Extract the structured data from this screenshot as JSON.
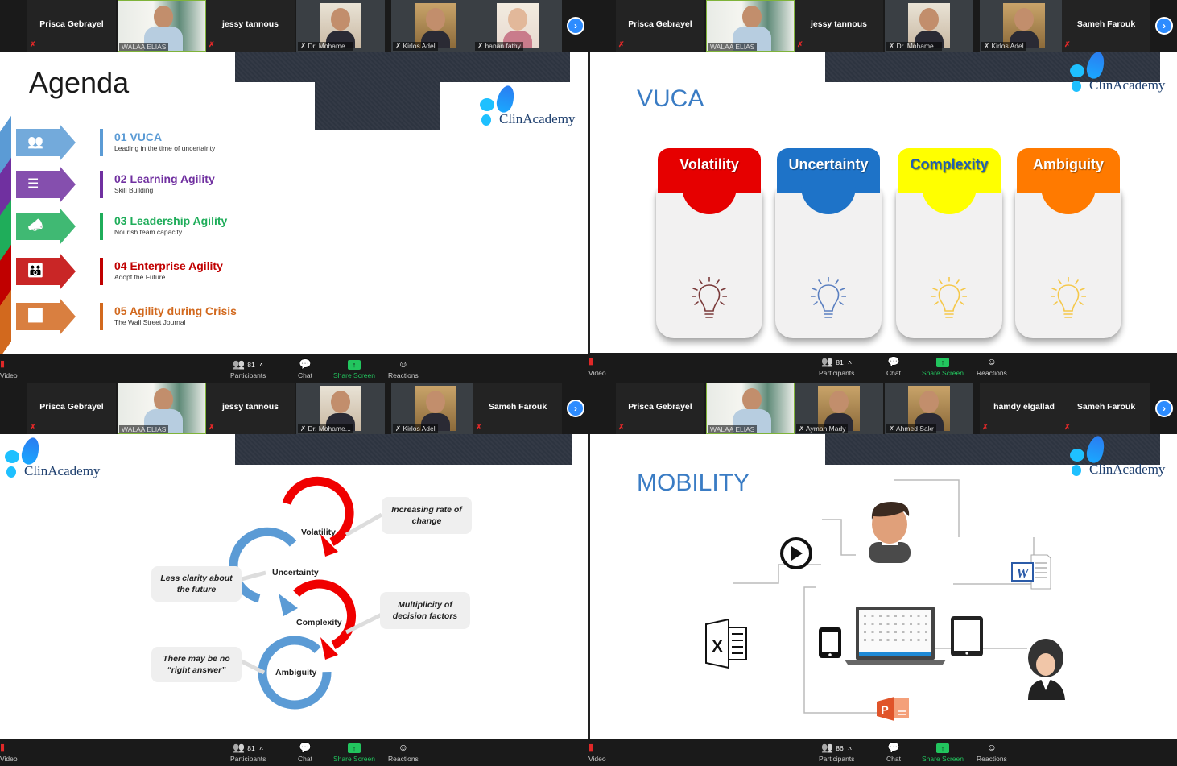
{
  "quadrants": [
    {
      "participants": [
        {
          "name": "Prisca Gebrayel",
          "type": "name",
          "muted": true
        },
        {
          "name": "WALAA ELIAS",
          "type": "video",
          "speaking": true
        },
        {
          "name": "jessy tannous",
          "type": "name",
          "muted": true
        },
        {
          "name": "Dr. Mohame...",
          "type": "photo",
          "muted": true
        },
        {
          "name": "Kirlos Adel",
          "type": "photo",
          "muted": true
        },
        {
          "name": "hanan fathy",
          "type": "photo",
          "muted": true
        }
      ],
      "toolbar": {
        "participants_count": "81"
      }
    },
    {
      "participants": [
        {
          "name": "Prisca Gebrayel",
          "type": "name",
          "muted": true
        },
        {
          "name": "WALAA ELIAS",
          "type": "video",
          "speaking": true
        },
        {
          "name": "jessy tannous",
          "type": "name",
          "muted": true
        },
        {
          "name": "Dr. Mohame...",
          "type": "photo",
          "muted": true
        },
        {
          "name": "Kirlos Adel",
          "type": "photo",
          "muted": true
        },
        {
          "name": "Sameh Farouk",
          "type": "name",
          "muted": true
        }
      ],
      "toolbar": {
        "participants_count": "81"
      }
    },
    {
      "participants": [
        {
          "name": "Prisca Gebrayel",
          "type": "name",
          "muted": true
        },
        {
          "name": "WALAA ELIAS",
          "type": "video",
          "speaking": true
        },
        {
          "name": "jessy tannous",
          "type": "name",
          "muted": true
        },
        {
          "name": "Dr. Mohame...",
          "type": "photo",
          "muted": true
        },
        {
          "name": "Kirlos Adel",
          "type": "photo",
          "muted": true
        },
        {
          "name": "Sameh Farouk",
          "type": "name",
          "muted": true
        }
      ],
      "toolbar": {
        "participants_count": "81"
      }
    },
    {
      "participants": [
        {
          "name": "Prisca Gebrayel",
          "type": "name",
          "muted": true
        },
        {
          "name": "WALAA ELIAS",
          "type": "video",
          "speaking": true
        },
        {
          "name": "Ayman Mady",
          "type": "photo",
          "muted": true
        },
        {
          "name": "Ahmed Sakr",
          "type": "photo",
          "muted": true
        },
        {
          "name": "hamdy elgallad",
          "type": "name",
          "muted": true
        },
        {
          "name": "Sameh Farouk",
          "type": "name",
          "muted": true
        }
      ],
      "toolbar": {
        "participants_count": "86"
      }
    }
  ],
  "toolbar_labels": {
    "video": "Video",
    "participants": "Participants",
    "chat": "Chat",
    "share_screen": "Share Screen",
    "reactions": "Reactions"
  },
  "logo_text": "ClinAcademy",
  "agenda": {
    "title": "Agenda",
    "items": [
      {
        "title": "01 VUCA",
        "subtitle": "Leading in the time of uncertainty",
        "color": "#5b9bd5",
        "icon": "people-icon"
      },
      {
        "title": "02 Learning Agility",
        "subtitle": "Skill Building",
        "color": "#7030a0",
        "icon": "checklist-icon"
      },
      {
        "title": "03 Leadership Agility",
        "subtitle": "Nourish team capacity",
        "color": "#1fad5a",
        "icon": "megaphone-icon"
      },
      {
        "title": "04 Enterprise Agility",
        "subtitle": "Adopt the Future.",
        "color": "#c00000",
        "icon": "team-icon"
      },
      {
        "title": "05 Agility during Crisis",
        "subtitle": "The Wall Street Journal",
        "color": "#d2691e",
        "icon": "chart-icon"
      }
    ]
  },
  "vuca": {
    "title": "VUCA",
    "cards": [
      {
        "label": "Volatility",
        "color": "#e60000",
        "text_color": "#ffffff",
        "bulb_color": "#7a3a3a"
      },
      {
        "label": "Uncertainty",
        "color": "#1e73c8",
        "text_color": "#ffffff",
        "bulb_color": "#5a7fc0"
      },
      {
        "label": "Complexity",
        "color": "#ffff00",
        "text_color": "#1e5fb4",
        "bulb_color": "#f5c84a"
      },
      {
        "label": "Ambiguity",
        "color": "#ff7a00",
        "text_color": "#ffffff",
        "bulb_color": "#f5c84a"
      }
    ]
  },
  "vuca_cycle": {
    "loops": [
      "Volatility",
      "Uncertainty",
      "Complexity",
      "Ambiguity"
    ],
    "callouts": [
      "Increasing rate of change",
      "Less clarity about the future",
      "Multiplicity of decision factors",
      "There may be no “right answer”"
    ]
  },
  "mobility": {
    "title": "MOBILITY",
    "nodes": [
      "play-icon",
      "male-user-icon",
      "word-doc-icon",
      "excel-icon",
      "phone-icon",
      "laptop-icon",
      "tablet-icon",
      "female-user-icon",
      "powerpoint-icon"
    ]
  }
}
